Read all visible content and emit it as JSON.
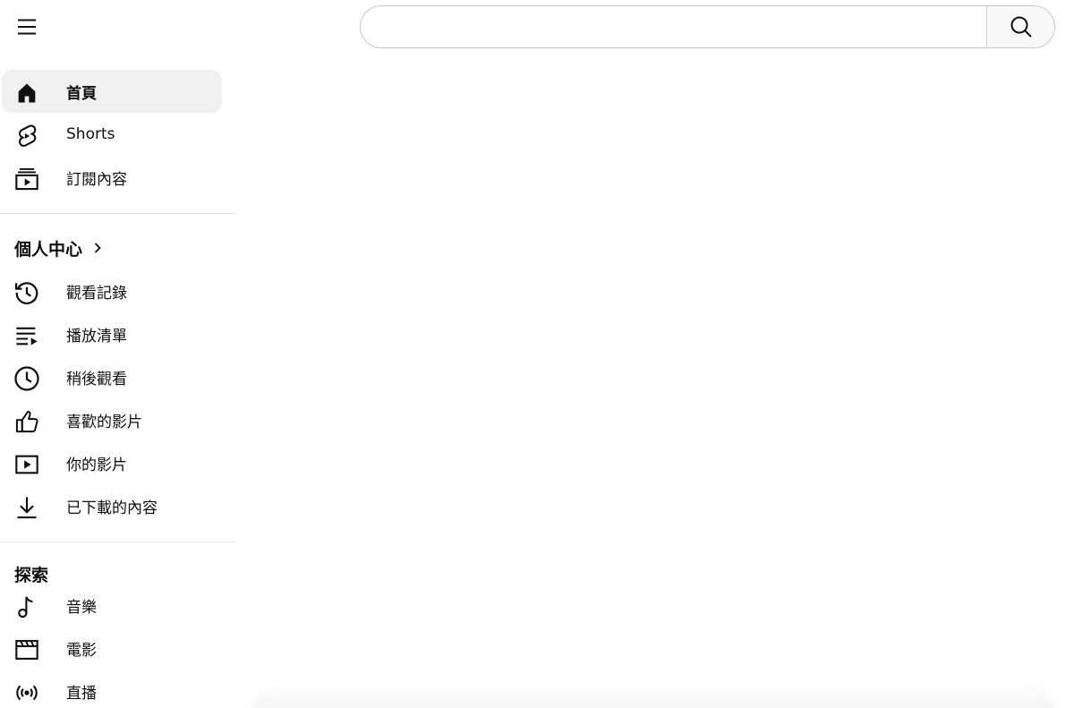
{
  "header": {
    "search": {
      "placeholder": "",
      "value": ""
    }
  },
  "sidebar": {
    "main": [
      {
        "label": "首頁",
        "icon": "home-icon",
        "active": true
      },
      {
        "label": "Shorts",
        "icon": "shorts-icon"
      },
      {
        "label": "訂閱內容",
        "icon": "subscriptions-icon"
      }
    ],
    "you": {
      "title": "個人中心",
      "items": [
        {
          "label": "觀看記錄",
          "icon": "history-icon"
        },
        {
          "label": "播放清單",
          "icon": "playlist-icon"
        },
        {
          "label": "稍後觀看",
          "icon": "clock-icon"
        },
        {
          "label": "喜歡的影片",
          "icon": "thumbs-up-icon"
        },
        {
          "label": "你的影片",
          "icon": "your-videos-icon"
        },
        {
          "label": "已下載的內容",
          "icon": "download-icon"
        }
      ]
    },
    "explore": {
      "title": "探索",
      "items": [
        {
          "label": "音樂",
          "icon": "music-note-icon"
        },
        {
          "label": "電影",
          "icon": "clapperboard-icon"
        },
        {
          "label": "直播",
          "icon": "live-broadcast-icon"
        }
      ]
    }
  }
}
